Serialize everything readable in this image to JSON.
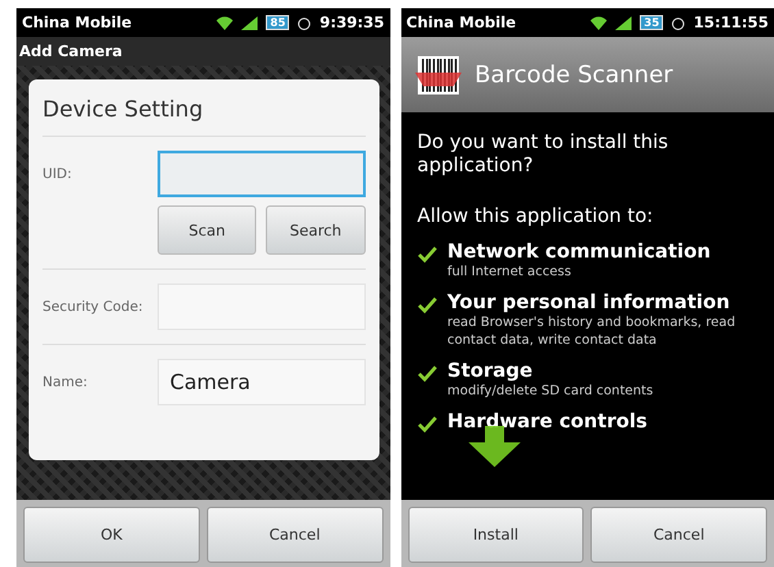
{
  "add_camera_screen": {
    "status_bar": {
      "carrier": "China Mobile",
      "battery": "85",
      "time": "9:39:35"
    },
    "title": "Add Camera",
    "dialog": {
      "title": "Device Setting",
      "uid": {
        "label": "UID:",
        "focused": true
      },
      "buttons": [
        "Scan",
        "Search"
      ],
      "security_code": {
        "label": "Security Code:"
      },
      "name": {
        "label": "Name:",
        "value": "Camera"
      }
    },
    "buttons": [
      "OK",
      "Cancel"
    ]
  },
  "install_screen": {
    "status_bar": {
      "carrier": "China Mobile",
      "battery": "35",
      "time": "15:11:55"
    },
    "title": "Barcode Scanner",
    "question": "Do you want to install this application?",
    "allow_heading": "Allow this application to:",
    "permissions": [
      {
        "title": "Network communication",
        "detail": "full Internet access"
      },
      {
        "title": "Your personal information",
        "detail": "read Browser's history and bookmarks, read contact data, write contact data"
      },
      {
        "title": "Storage",
        "detail": "modify/delete SD card contents"
      },
      {
        "title": "Hardware controls"
      }
    ],
    "buttons": [
      "Install",
      "Cancel"
    ]
  }
}
